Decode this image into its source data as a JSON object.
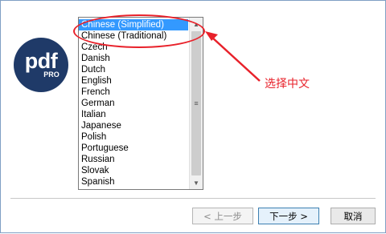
{
  "logo": {
    "main": "pdf",
    "sub": "PRO"
  },
  "language_list": {
    "items": [
      "Chinese (Simplified)",
      "Chinese (Traditional)",
      "Czech",
      "Danish",
      "Dutch",
      "English",
      "French",
      "German",
      "Italian",
      "Japanese",
      "Polish",
      "Portuguese",
      "Russian",
      "Slovak",
      "Spanish"
    ],
    "selected": "Chinese (Simplified)"
  },
  "annotation": {
    "text": "选择中文",
    "color": "#e8212a"
  },
  "buttons": {
    "back": "< 上一步",
    "next": "下一步 >",
    "cancel": "取消"
  },
  "colors": {
    "selection": "#3399ff",
    "brand": "#1f3a68",
    "frame_border": "#7f9fc4"
  }
}
